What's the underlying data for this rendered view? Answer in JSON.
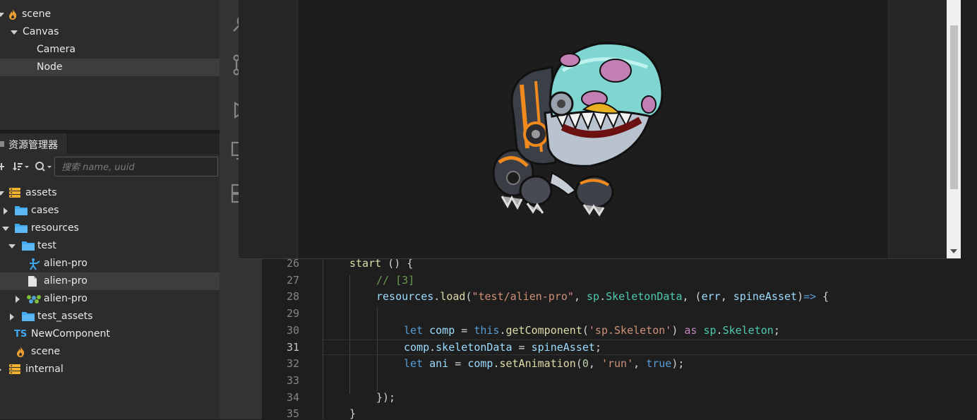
{
  "hierarchy": {
    "items": [
      {
        "label": "scene",
        "icon": "flame-icon",
        "expanded": true
      },
      {
        "label": "Canvas",
        "expanded": true
      },
      {
        "label": "Camera"
      },
      {
        "label": "Node",
        "selected": true
      }
    ]
  },
  "assets": {
    "tab_label": "资源管理器",
    "search": {
      "placeholder": "搜索 name, uuid",
      "value": ""
    },
    "tree": [
      {
        "label": "assets",
        "icon": "database-icon"
      },
      {
        "label": "cases",
        "icon": "folder-icon"
      },
      {
        "label": "resources",
        "icon": "folder-icon"
      },
      {
        "label": "test",
        "icon": "folder-icon"
      },
      {
        "label": "alien-pro",
        "icon": "skeleton-icon"
      },
      {
        "label": "alien-pro",
        "icon": "file-icon",
        "selected": true
      },
      {
        "label": "alien-pro",
        "icon": "atlas-icon"
      },
      {
        "label": "test_assets",
        "icon": "folder-icon"
      },
      {
        "label": "NewComponent",
        "icon": "typescript-icon",
        "icon_text": "TS"
      },
      {
        "label": "scene",
        "icon": "flame-icon"
      },
      {
        "label": "internal",
        "icon": "database-icon"
      }
    ]
  },
  "editor": {
    "current_line": "31",
    "lines": [
      {
        "num": "26",
        "segs": [
          [
            "start",
            "fn"
          ],
          [
            " () {",
            ""
          ]
        ]
      },
      {
        "num": "27",
        "segs": [
          [
            "// [3]",
            "cm"
          ]
        ]
      },
      {
        "num": "28",
        "segs": [
          [
            "resources",
            "var"
          ],
          [
            ".",
            ""
          ],
          [
            "load",
            "fn"
          ],
          [
            "(",
            ""
          ],
          [
            "\"test/alien-pro\"",
            "str"
          ],
          [
            ", ",
            ""
          ],
          [
            "sp",
            "ty"
          ],
          [
            ".",
            ""
          ],
          [
            "SkeletonData",
            "ty"
          ],
          [
            ", (",
            ""
          ],
          [
            "err",
            "var"
          ],
          [
            ", ",
            ""
          ],
          [
            "spineAsset",
            "var"
          ],
          [
            ")",
            ""
          ],
          [
            "=>",
            "kw"
          ],
          [
            " {",
            ""
          ]
        ]
      },
      {
        "num": "29",
        "segs": []
      },
      {
        "num": "30",
        "segs": [
          [
            "let",
            "kw"
          ],
          [
            " ",
            ""
          ],
          [
            "comp",
            "var"
          ],
          [
            " = ",
            ""
          ],
          [
            "this",
            "kw"
          ],
          [
            ".",
            ""
          ],
          [
            "getComponent",
            "fn"
          ],
          [
            "(",
            ""
          ],
          [
            "'sp.Skeleton'",
            "str"
          ],
          [
            ") ",
            ""
          ],
          [
            "as",
            "ctl"
          ],
          [
            " ",
            ""
          ],
          [
            "sp",
            "ty"
          ],
          [
            ".",
            ""
          ],
          [
            "Skeleton",
            "ty"
          ],
          [
            ";",
            ""
          ]
        ]
      },
      {
        "num": "31",
        "segs": [
          [
            "comp",
            "var"
          ],
          [
            ".",
            ""
          ],
          [
            "skeletonData",
            "var"
          ],
          [
            " = ",
            ""
          ],
          [
            "spineAsset",
            "var"
          ],
          [
            ";",
            ""
          ]
        ]
      },
      {
        "num": "32",
        "segs": [
          [
            "let",
            "kw"
          ],
          [
            " ",
            ""
          ],
          [
            "ani",
            "var"
          ],
          [
            " = ",
            ""
          ],
          [
            "comp",
            "var"
          ],
          [
            ".",
            ""
          ],
          [
            "setAnimation",
            "fn"
          ],
          [
            "(",
            ""
          ],
          [
            "0",
            "num"
          ],
          [
            ", ",
            ""
          ],
          [
            "'run'",
            "str"
          ],
          [
            ", ",
            ""
          ],
          [
            "true",
            "kw"
          ],
          [
            ");",
            ""
          ]
        ]
      },
      {
        "num": "33",
        "segs": []
      },
      {
        "num": "34",
        "segs": [
          [
            "});",
            ""
          ]
        ]
      },
      {
        "num": "35",
        "segs": [
          [
            "}",
            ""
          ]
        ]
      }
    ]
  },
  "preview": {
    "image": "alien-pro-robot-dinosaur"
  },
  "colors": {
    "panel": "#2c2c2c",
    "selected": "#3d3d3d",
    "folder": "#3ea8f0",
    "flame": "#f0a030",
    "editor_bg": "#1e1e1e"
  }
}
